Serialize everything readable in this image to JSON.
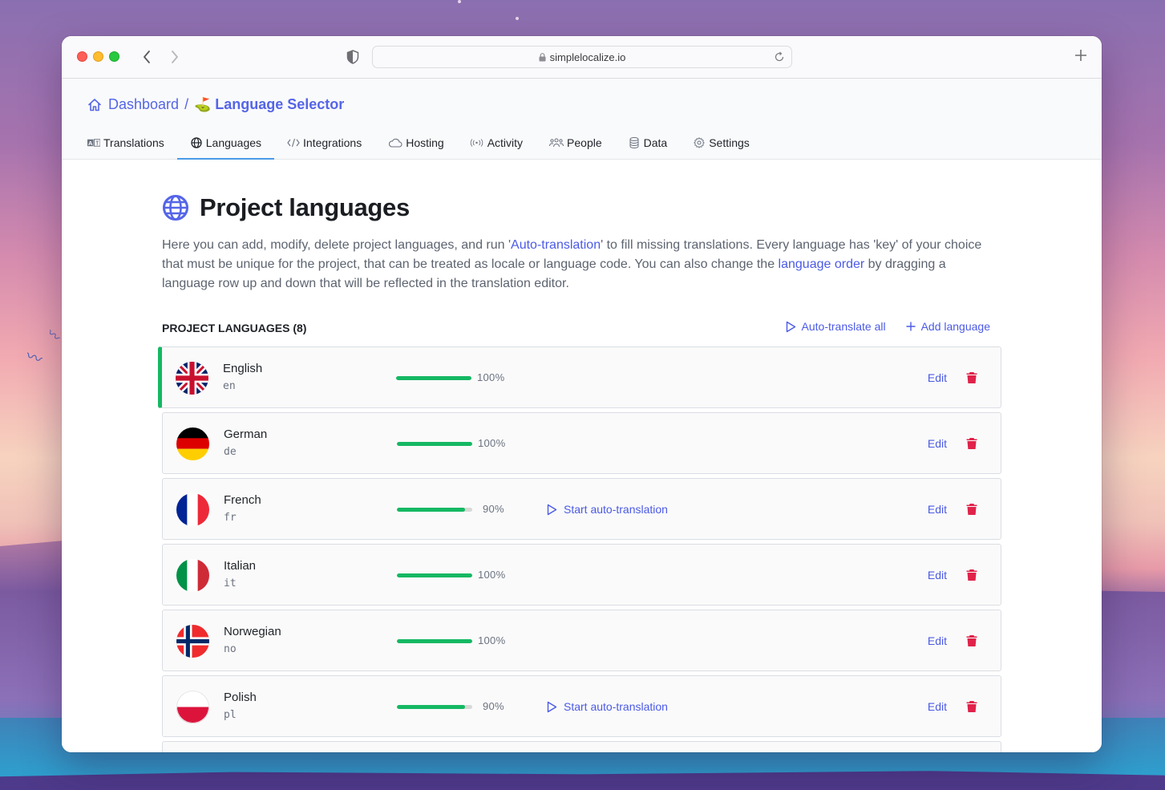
{
  "browser": {
    "url": "simplelocalize.io"
  },
  "breadcrumb": {
    "root": "Dashboard",
    "separator": "/",
    "project_emoji": "⛳",
    "project": "Language Selector"
  },
  "tabs": [
    {
      "label": "Translations",
      "icon": "translate-icon",
      "active": false
    },
    {
      "label": "Languages",
      "icon": "globe-icon",
      "active": true
    },
    {
      "label": "Integrations",
      "icon": "code-icon",
      "active": false
    },
    {
      "label": "Hosting",
      "icon": "cloud-icon",
      "active": false
    },
    {
      "label": "Activity",
      "icon": "broadcast-icon",
      "active": false
    },
    {
      "label": "People",
      "icon": "people-icon",
      "active": false
    },
    {
      "label": "Data",
      "icon": "database-icon",
      "active": false
    },
    {
      "label": "Settings",
      "icon": "gear-icon",
      "active": false
    }
  ],
  "page": {
    "title": "Project languages",
    "intro": {
      "part1": "Here you can add, modify, delete project languages, and run '",
      "link1": "Auto-translation",
      "part2": "' to fill missing translations. Every language has 'key' of your choice that must be unique for the project, that can be treated as locale or language code. You can also change the ",
      "link2": "language order",
      "part3": " by dragging a language row up and down that will be reflected in the translation editor."
    }
  },
  "section": {
    "title": "PROJECT LANGUAGES (8)",
    "auto_translate_all": "Auto-translate all",
    "add_language": "Add language"
  },
  "languages": [
    {
      "name": "English",
      "key": "en",
      "progress_pct": 100,
      "progress_label": "100%",
      "show_auto": false
    },
    {
      "name": "German",
      "key": "de",
      "progress_pct": 100,
      "progress_label": "100%",
      "show_auto": false
    },
    {
      "name": "French",
      "key": "fr",
      "progress_pct": 90,
      "progress_label": "90%",
      "show_auto": true
    },
    {
      "name": "Italian",
      "key": "it",
      "progress_pct": 100,
      "progress_label": "100%",
      "show_auto": false
    },
    {
      "name": "Norwegian",
      "key": "no",
      "progress_pct": 100,
      "progress_label": "100%",
      "show_auto": false
    },
    {
      "name": "Polish",
      "key": "pl",
      "progress_pct": 90,
      "progress_label": "90%",
      "show_auto": true
    }
  ],
  "row_actions": {
    "start_auto": "Start auto-translation",
    "edit": "Edit"
  },
  "colors": {
    "accent": "#4b5ae6",
    "progress": "#15b863",
    "delete": "#e0234a",
    "active_tab_underline": "#4a9be6"
  }
}
